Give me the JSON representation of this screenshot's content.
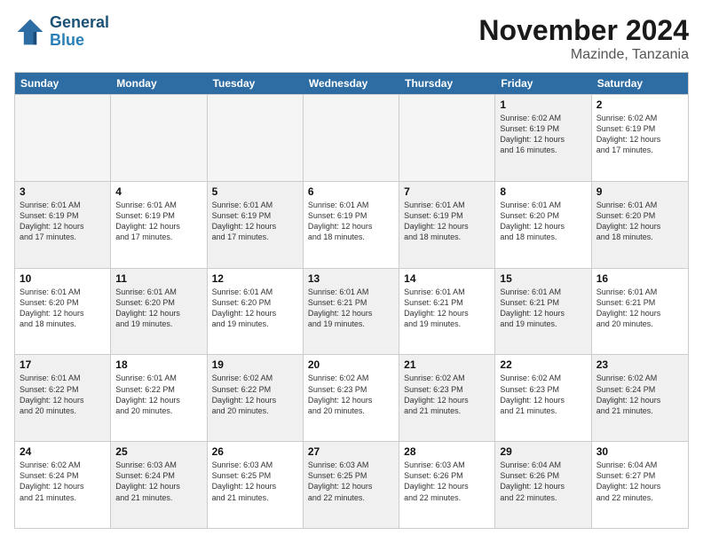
{
  "header": {
    "logo_line1": "General",
    "logo_line2": "Blue",
    "month": "November 2024",
    "location": "Mazinde, Tanzania"
  },
  "weekdays": [
    "Sunday",
    "Monday",
    "Tuesday",
    "Wednesday",
    "Thursday",
    "Friday",
    "Saturday"
  ],
  "rows": [
    [
      {
        "day": "",
        "info": "",
        "empty": true
      },
      {
        "day": "",
        "info": "",
        "empty": true
      },
      {
        "day": "",
        "info": "",
        "empty": true
      },
      {
        "day": "",
        "info": "",
        "empty": true
      },
      {
        "day": "",
        "info": "",
        "empty": true
      },
      {
        "day": "1",
        "info": "Sunrise: 6:02 AM\nSunset: 6:19 PM\nDaylight: 12 hours\nand 16 minutes.",
        "shaded": true
      },
      {
        "day": "2",
        "info": "Sunrise: 6:02 AM\nSunset: 6:19 PM\nDaylight: 12 hours\nand 17 minutes.",
        "shaded": false
      }
    ],
    [
      {
        "day": "3",
        "info": "Sunrise: 6:01 AM\nSunset: 6:19 PM\nDaylight: 12 hours\nand 17 minutes.",
        "shaded": true
      },
      {
        "day": "4",
        "info": "Sunrise: 6:01 AM\nSunset: 6:19 PM\nDaylight: 12 hours\nand 17 minutes.",
        "shaded": false
      },
      {
        "day": "5",
        "info": "Sunrise: 6:01 AM\nSunset: 6:19 PM\nDaylight: 12 hours\nand 17 minutes.",
        "shaded": true
      },
      {
        "day": "6",
        "info": "Sunrise: 6:01 AM\nSunset: 6:19 PM\nDaylight: 12 hours\nand 18 minutes.",
        "shaded": false
      },
      {
        "day": "7",
        "info": "Sunrise: 6:01 AM\nSunset: 6:19 PM\nDaylight: 12 hours\nand 18 minutes.",
        "shaded": true
      },
      {
        "day": "8",
        "info": "Sunrise: 6:01 AM\nSunset: 6:20 PM\nDaylight: 12 hours\nand 18 minutes.",
        "shaded": false
      },
      {
        "day": "9",
        "info": "Sunrise: 6:01 AM\nSunset: 6:20 PM\nDaylight: 12 hours\nand 18 minutes.",
        "shaded": true
      }
    ],
    [
      {
        "day": "10",
        "info": "Sunrise: 6:01 AM\nSunset: 6:20 PM\nDaylight: 12 hours\nand 18 minutes.",
        "shaded": false
      },
      {
        "day": "11",
        "info": "Sunrise: 6:01 AM\nSunset: 6:20 PM\nDaylight: 12 hours\nand 19 minutes.",
        "shaded": true
      },
      {
        "day": "12",
        "info": "Sunrise: 6:01 AM\nSunset: 6:20 PM\nDaylight: 12 hours\nand 19 minutes.",
        "shaded": false
      },
      {
        "day": "13",
        "info": "Sunrise: 6:01 AM\nSunset: 6:21 PM\nDaylight: 12 hours\nand 19 minutes.",
        "shaded": true
      },
      {
        "day": "14",
        "info": "Sunrise: 6:01 AM\nSunset: 6:21 PM\nDaylight: 12 hours\nand 19 minutes.",
        "shaded": false
      },
      {
        "day": "15",
        "info": "Sunrise: 6:01 AM\nSunset: 6:21 PM\nDaylight: 12 hours\nand 19 minutes.",
        "shaded": true
      },
      {
        "day": "16",
        "info": "Sunrise: 6:01 AM\nSunset: 6:21 PM\nDaylight: 12 hours\nand 20 minutes.",
        "shaded": false
      }
    ],
    [
      {
        "day": "17",
        "info": "Sunrise: 6:01 AM\nSunset: 6:22 PM\nDaylight: 12 hours\nand 20 minutes.",
        "shaded": true
      },
      {
        "day": "18",
        "info": "Sunrise: 6:01 AM\nSunset: 6:22 PM\nDaylight: 12 hours\nand 20 minutes.",
        "shaded": false
      },
      {
        "day": "19",
        "info": "Sunrise: 6:02 AM\nSunset: 6:22 PM\nDaylight: 12 hours\nand 20 minutes.",
        "shaded": true
      },
      {
        "day": "20",
        "info": "Sunrise: 6:02 AM\nSunset: 6:23 PM\nDaylight: 12 hours\nand 20 minutes.",
        "shaded": false
      },
      {
        "day": "21",
        "info": "Sunrise: 6:02 AM\nSunset: 6:23 PM\nDaylight: 12 hours\nand 21 minutes.",
        "shaded": true
      },
      {
        "day": "22",
        "info": "Sunrise: 6:02 AM\nSunset: 6:23 PM\nDaylight: 12 hours\nand 21 minutes.",
        "shaded": false
      },
      {
        "day": "23",
        "info": "Sunrise: 6:02 AM\nSunset: 6:24 PM\nDaylight: 12 hours\nand 21 minutes.",
        "shaded": true
      }
    ],
    [
      {
        "day": "24",
        "info": "Sunrise: 6:02 AM\nSunset: 6:24 PM\nDaylight: 12 hours\nand 21 minutes.",
        "shaded": false
      },
      {
        "day": "25",
        "info": "Sunrise: 6:03 AM\nSunset: 6:24 PM\nDaylight: 12 hours\nand 21 minutes.",
        "shaded": true
      },
      {
        "day": "26",
        "info": "Sunrise: 6:03 AM\nSunset: 6:25 PM\nDaylight: 12 hours\nand 21 minutes.",
        "shaded": false
      },
      {
        "day": "27",
        "info": "Sunrise: 6:03 AM\nSunset: 6:25 PM\nDaylight: 12 hours\nand 22 minutes.",
        "shaded": true
      },
      {
        "day": "28",
        "info": "Sunrise: 6:03 AM\nSunset: 6:26 PM\nDaylight: 12 hours\nand 22 minutes.",
        "shaded": false
      },
      {
        "day": "29",
        "info": "Sunrise: 6:04 AM\nSunset: 6:26 PM\nDaylight: 12 hours\nand 22 minutes.",
        "shaded": true
      },
      {
        "day": "30",
        "info": "Sunrise: 6:04 AM\nSunset: 6:27 PM\nDaylight: 12 hours\nand 22 minutes.",
        "shaded": false
      }
    ]
  ]
}
